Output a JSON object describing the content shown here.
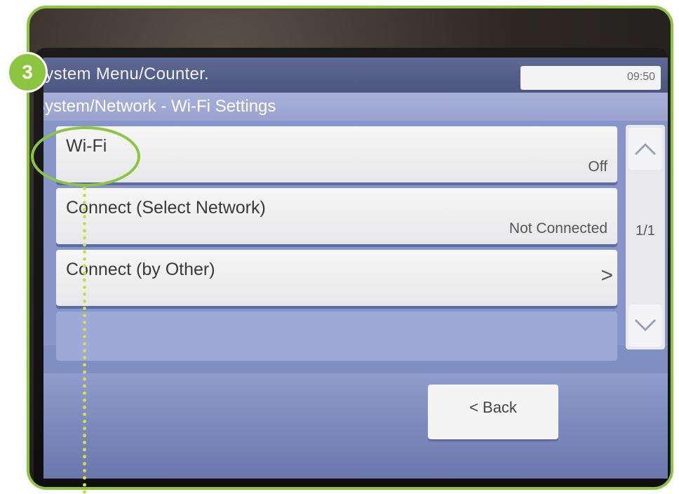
{
  "step": {
    "number": "3"
  },
  "header": {
    "title": "System Menu/Counter.",
    "time": "09:50"
  },
  "breadcrumb": "System/Network - Wi-Fi Settings",
  "rows": [
    {
      "label": "Wi-Fi",
      "value": "Off"
    },
    {
      "label": "Connect (Select Network)",
      "value": "Not Connected"
    },
    {
      "label": "Connect (by Other)",
      "chevron": ">"
    }
  ],
  "scroll": {
    "page_indicator": "1/1",
    "up_icon": "chevron-up-icon",
    "down_icon": "chevron-down-icon"
  },
  "footer": {
    "back_label": "< Back"
  },
  "colors": {
    "accent": "#8cc63f",
    "screen": "#8795c9",
    "header": "#4b5680"
  }
}
